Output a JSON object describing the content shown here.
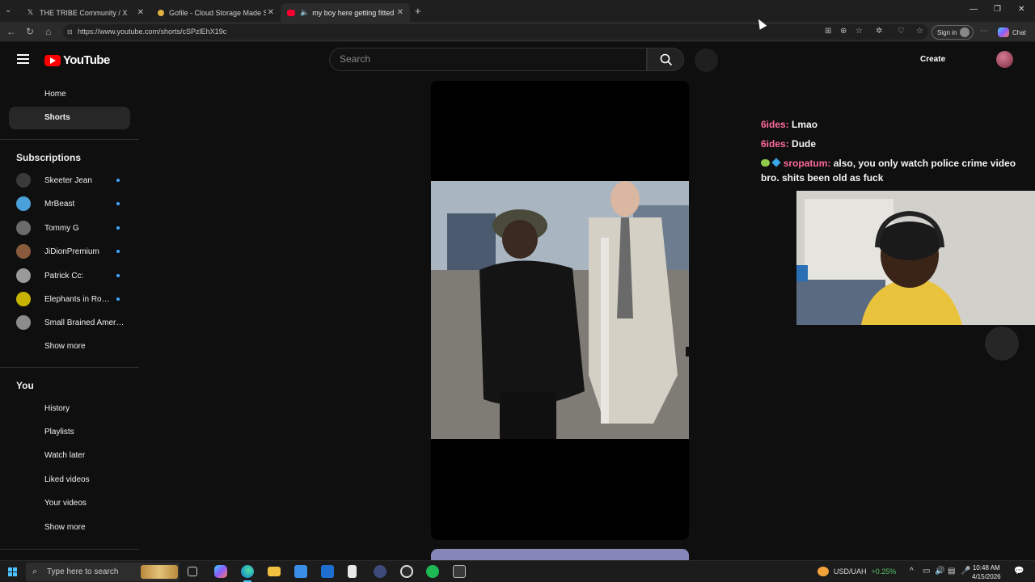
{
  "browser": {
    "tabs": [
      {
        "title": "THE TRIBE Community / X",
        "icon": "x-logo-icon"
      },
      {
        "title": "Gofile - Cloud Storage Made Simple",
        "icon": "gofile-icon"
      },
      {
        "title": "my boy here getting fitted for a suit",
        "icon": "youtube-icon"
      }
    ],
    "new_tab": "+",
    "url": "https://www.youtube.com/shorts/cSPzlEhX19c",
    "sign_in": "Sign in",
    "chat": "Chat"
  },
  "youtube": {
    "logo_text": "YouTube",
    "search_placeholder": "Search",
    "create": "Create",
    "nav": {
      "home": "Home",
      "shorts": "Shorts"
    },
    "subscriptions_heading": "Subscriptions",
    "subscriptions": [
      {
        "name": "Skeeter Jean",
        "color": "#3a3a3a"
      },
      {
        "name": "MrBeast",
        "color": "#4aa0d8"
      },
      {
        "name": "Tommy G",
        "color": "#6b6b6b"
      },
      {
        "name": "JiDionPremium",
        "color": "#8a5a3c"
      },
      {
        "name": "Patrick Cc:",
        "color": "#9a9a9a"
      },
      {
        "name": "Elephants in Room",
        "color": "#c8b400"
      },
      {
        "name": "Small Brained America",
        "color": "#8c8c8c"
      }
    ],
    "subs_show_more": "Show more",
    "you_heading": "You",
    "you_items": [
      "History",
      "Playlists",
      "Watch later",
      "Liked videos",
      "Your videos"
    ],
    "you_show_more": "Show more"
  },
  "stream_chat": [
    {
      "user": "6ides",
      "sep": ":",
      "message": "Lmao"
    },
    {
      "user": "6ides",
      "sep": ":",
      "message": "Dude"
    },
    {
      "user": "sropatum",
      "sep": ":",
      "message": "also, you only watch police crime video",
      "message2": "bro. shits been old as fuck"
    }
  ],
  "taskbar": {
    "search_placeholder": "Type here to search",
    "ticker_pair": "USD/UAH",
    "ticker_change": "+0.25%",
    "time": "10:48 AM",
    "date": "4/15/2026"
  }
}
